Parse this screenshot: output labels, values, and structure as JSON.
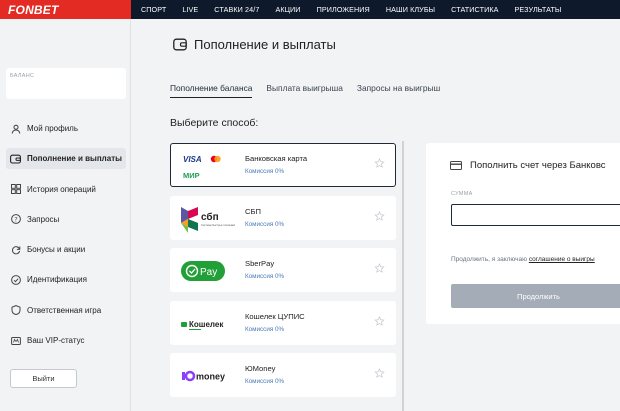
{
  "brand": {
    "logo": "FONBET",
    "color": "#e32b23"
  },
  "nav": [
    "СПОРТ",
    "LIVE",
    "СТАВКИ 24/7",
    "АКЦИИ",
    "ПРИЛОЖЕНИЯ",
    "НАШИ КЛУБЫ",
    "СТАТИСТИКА",
    "РЕЗУЛЬТАТЫ"
  ],
  "balance": {
    "label": "БАЛАНС"
  },
  "sidebar": {
    "items": [
      {
        "label": "Мой профиль",
        "icon": "user-icon",
        "active": false
      },
      {
        "label": "Пополнение и выплаты",
        "icon": "wallet-icon",
        "active": true
      },
      {
        "label": "История операций",
        "icon": "grid-icon",
        "active": false
      },
      {
        "label": "Запросы",
        "icon": "question-icon",
        "active": false
      },
      {
        "label": "Бонусы и акции",
        "icon": "refresh-icon",
        "active": false
      },
      {
        "label": "Идентификация",
        "icon": "id-icon",
        "active": false
      },
      {
        "label": "Ответственная игра",
        "icon": "shield-icon",
        "active": false
      },
      {
        "label": "Ваш VIP-статус",
        "icon": "crown-icon",
        "active": false
      }
    ],
    "logout_label": "Выйти"
  },
  "page": {
    "title": "Пополнение и выплаты"
  },
  "tabs": [
    {
      "label": "Пополнение баланса",
      "active": true
    },
    {
      "label": "Выплата выигрыша",
      "active": false
    },
    {
      "label": "Запросы на выигрыш",
      "active": false
    }
  ],
  "section_title": "Выберите способ:",
  "methods": [
    {
      "name": "Банковская карта",
      "fee": "Комиссия 0%",
      "logo": "visa-mastercard-mir-logo",
      "logo_text": [
        "VISA",
        "МИР"
      ]
    },
    {
      "name": "СБП",
      "fee": "Комиссия 0%",
      "logo": "sbp-logo",
      "logo_text": [
        "сбп",
        "Система быстрых платежей"
      ]
    },
    {
      "name": "SberPay",
      "fee": "Комиссия 0%",
      "logo": "sberpay-logo",
      "logo_text": [
        "Pay"
      ]
    },
    {
      "name": "Кошелек ЦУПИС",
      "fee": "Комиссия 0%",
      "logo": "koshelek-logo",
      "logo_text": [
        "Кошелек"
      ]
    },
    {
      "name": "ЮMoney",
      "fee": "Комиссия 0%",
      "logo": "yumoney-logo",
      "logo_text": [
        "money"
      ]
    }
  ],
  "panel": {
    "title": "Пополнить счет через Банковс",
    "sum_label": "СУММА",
    "agree_text": "Продолжить, я заключаю",
    "agree_link": "соглашение о выигры",
    "continue_label": "Продолжить"
  }
}
